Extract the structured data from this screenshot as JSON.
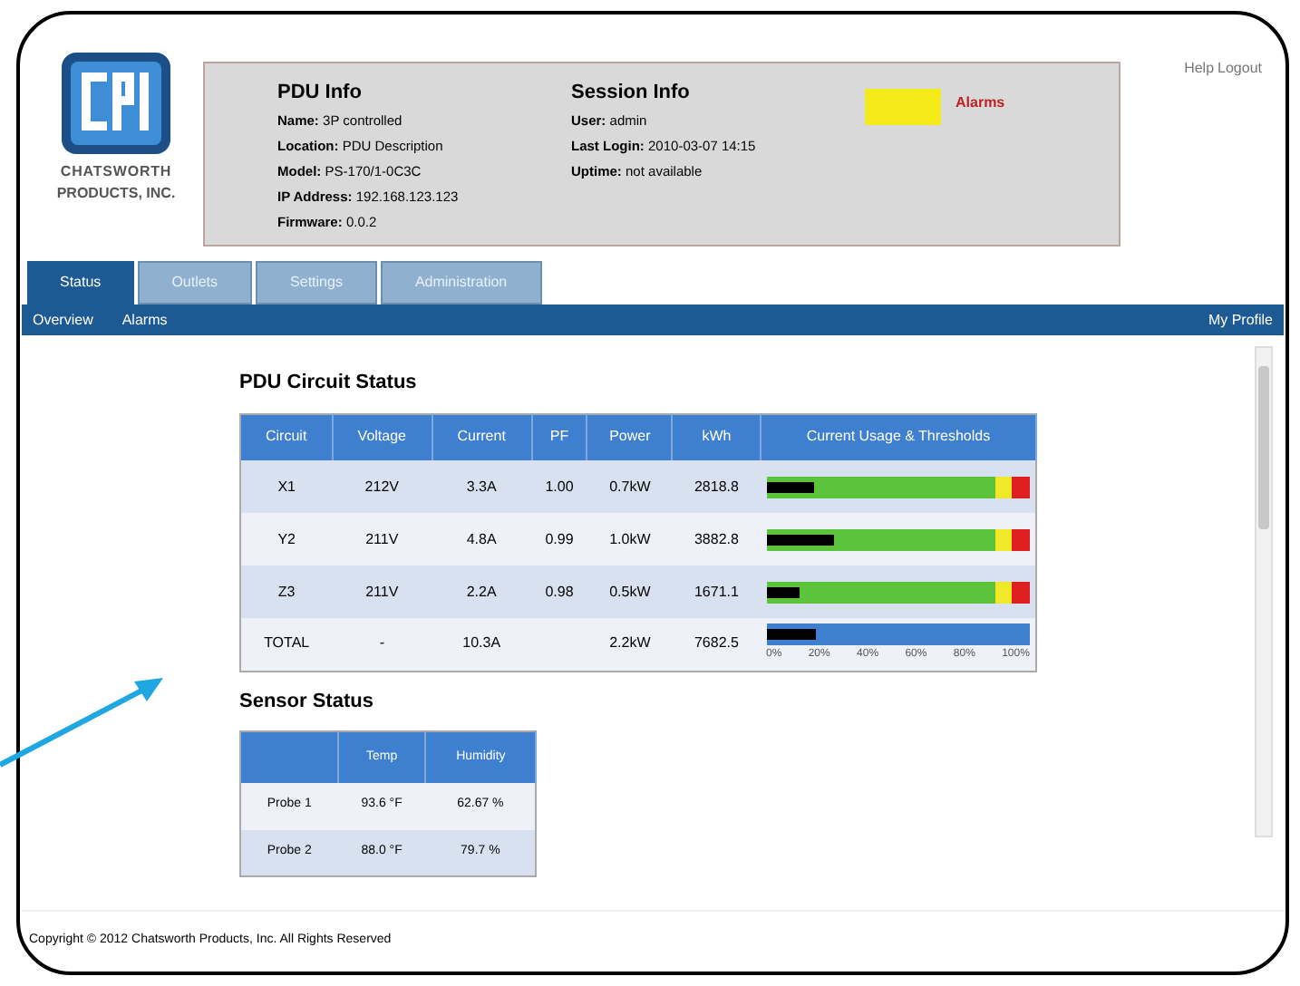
{
  "logo": {
    "company_line_1": "CHATSWORTH",
    "company_line_2": "PRODUCTS, INC."
  },
  "pdu_info": {
    "title": "PDU Info",
    "lines": [
      {
        "label": "Name:",
        "value": "3P controlled"
      },
      {
        "label": "Location:",
        "value": "PDU Description"
      },
      {
        "label": "Model:",
        "value": "PS-170/1-0C3C"
      },
      {
        "label": "IP Address:",
        "value": "192.168.123.123"
      },
      {
        "label": "Firmware:",
        "value": "0.0.2"
      }
    ]
  },
  "session_info": {
    "title": "Session Info",
    "lines": [
      {
        "label": "User:",
        "value": "admin"
      },
      {
        "label": "Last Login:",
        "value": "2010-03-07 14:15"
      },
      {
        "label": "Uptime:",
        "value": "not available"
      }
    ]
  },
  "alarm": {
    "color": "#f5ea1a",
    "label": "Alarms"
  },
  "top_links": [
    "Help",
    "Logout"
  ],
  "tabs": [
    {
      "label": "Status",
      "selected": true
    },
    {
      "label": "Outlets",
      "selected": false
    },
    {
      "label": "Settings",
      "selected": false
    },
    {
      "label": "Administration",
      "selected": false
    }
  ],
  "subnav": {
    "items": [
      "Overview",
      "Alarms"
    ],
    "right": "My Profile"
  },
  "circuit_status": {
    "title": "PDU Circuit Status",
    "columns": [
      "Circuit",
      "Voltage",
      "Current",
      "PF",
      "Power",
      "kWh",
      "Current Usage & Thresholds"
    ],
    "rows": [
      {
        "cells": [
          "X1",
          "212V",
          "3.3A",
          "1.00",
          "0.7kW",
          "2818.8"
        ],
        "kind": "threshold",
        "level": 0.18
      },
      {
        "cells": [
          "Y2",
          "211V",
          "4.8A",
          "0.99",
          "1.0kW",
          "3882.8"
        ],
        "kind": "threshold",
        "level": 0.26
      },
      {
        "cells": [
          "Z3",
          "211V",
          "2.2A",
          "0.98",
          "0.5kW",
          "1671.1"
        ],
        "kind": "threshold",
        "level": 0.13
      },
      {
        "cells": [
          "TOTAL",
          "-",
          "10.3A",
          "",
          "2.2kW",
          "7682.5"
        ],
        "kind": "total",
        "level": 0.19
      }
    ],
    "scale": [
      "0%",
      "20%",
      "40%",
      "60%",
      "80%",
      "100%"
    ]
  },
  "sensor_status": {
    "title": "Sensor Status",
    "columns": [
      "",
      "Temp",
      "Humidity"
    ],
    "rows": [
      [
        "Probe 1",
        "93.6 °F",
        "62.67 %"
      ],
      [
        "Probe 2",
        "88.0 °F",
        "79.7 %"
      ]
    ]
  },
  "footer": "Copyright © 2012 Chatsworth Products, Inc. All Rights Reserved"
}
